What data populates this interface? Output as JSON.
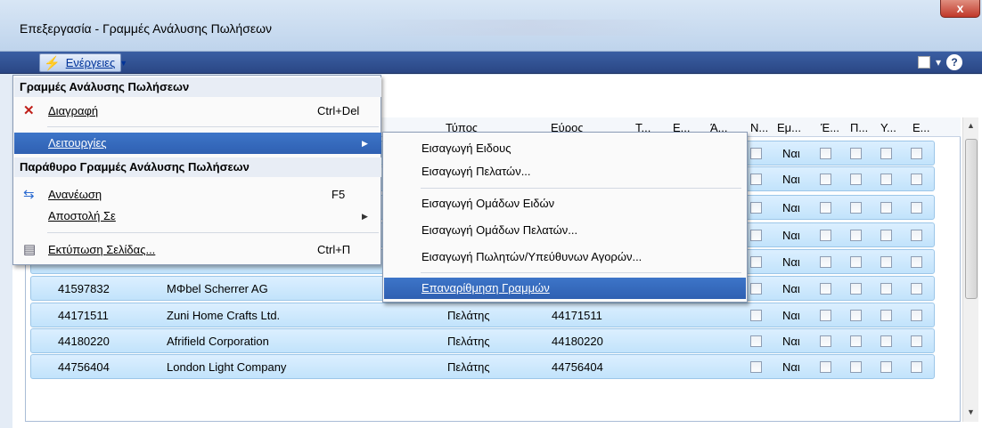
{
  "window": {
    "title": "Επεξεργασία - Γραμμές Ανάλυσης Πωλήσεων",
    "close_label": "x"
  },
  "toolbar": {
    "actions_label": "Ενέργειες",
    "help_label": "?"
  },
  "grid": {
    "columns": [
      "Τύπος",
      "Εύρος",
      "Τ...",
      "Ε...",
      "Ά...",
      "Ν...",
      "Εμ...",
      "Έ...",
      "Π...",
      "Υ...",
      "Ε..."
    ],
    "rows": [
      {
        "no": "41597832",
        "name": "MΦbel Scherrer AG",
        "type": "",
        "range": "",
        "em": "Ναι"
      },
      {
        "no": "44171511",
        "name": "Zuni Home Crafts Ltd.",
        "type": "Πελάτης",
        "range": "44171511",
        "em": "Ναι"
      },
      {
        "no": "44180220",
        "name": "Afrifield Corporation",
        "type": "Πελάτης",
        "range": "44180220",
        "em": "Ναι"
      },
      {
        "no": "44756404",
        "name": "London Light Company",
        "type": "Πελάτης",
        "range": "44756404",
        "em": "Ναι"
      }
    ],
    "hidden_rows_em": [
      "Ναι",
      "Ναι",
      "Ναι",
      "Ναι",
      "Ναι"
    ]
  },
  "menu": {
    "section1": "Γραμμές Ανάλυσης Πωλήσεων",
    "delete": {
      "label": "Διαγραφή",
      "shortcut": "Ctrl+Del"
    },
    "functions": {
      "label": "Λειτουργίες"
    },
    "section2": "Παράθυρο Γραμμές Ανάλυσης Πωλήσεων",
    "refresh": {
      "label": "Ανανέωση",
      "shortcut": "F5"
    },
    "send_to": {
      "label": "Αποστολή Σε"
    },
    "print": {
      "label": "Εκτύπωση Σελίδας...",
      "shortcut": "Ctrl+Π"
    }
  },
  "submenu": {
    "items": [
      "Εισαγωγή Ειδους",
      "Εισαγωγή Πελατών...",
      "Εισαγωγή Ομάδων Ειδών",
      "Εισαγωγή Ομάδων Πελατών...",
      "Εισαγωγή Πωλητών/Υπεύθυνων Αγορών...",
      "Επαναρίθμηση Γραμμών"
    ]
  },
  "colors": {
    "highlight": "#3366bb",
    "titlebar": "#c9dbef",
    "toolbar": "#2f4f8f"
  }
}
